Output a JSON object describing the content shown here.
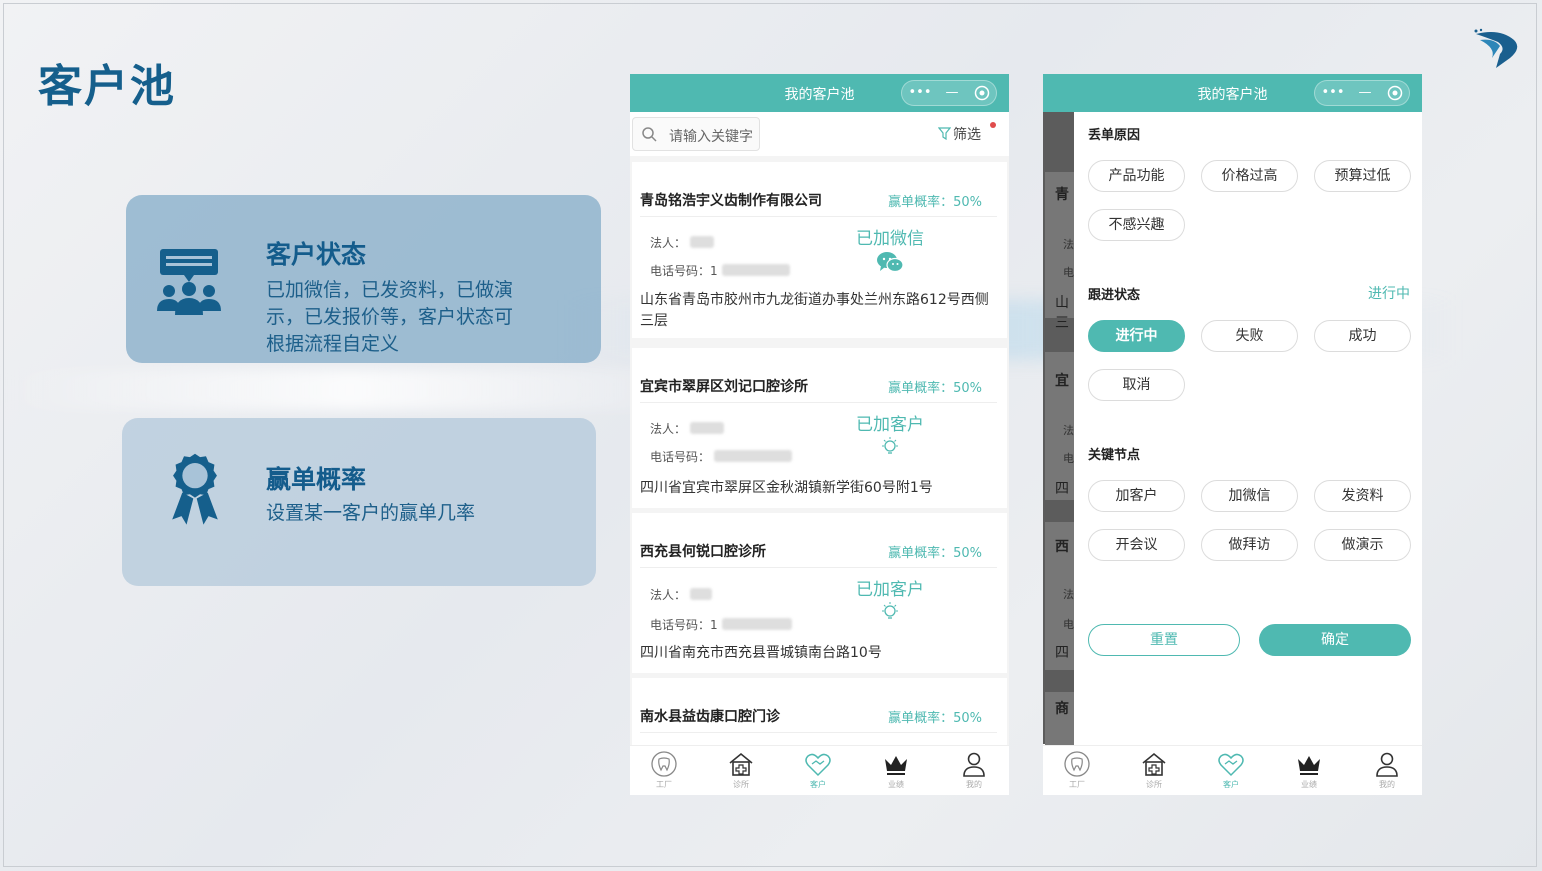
{
  "slide": {
    "title": "客户池",
    "features": [
      {
        "title": "客户状态",
        "description": "已加微信，已发资料，已做演示，已发报价等，客户状态可根据流程自定义",
        "icon": "presentation-people-icon"
      },
      {
        "title": "赢单概率",
        "description": "设置某一客户的赢单几率",
        "icon": "award-ribbon-icon"
      }
    ]
  },
  "colors": {
    "accent": "#4fb9b1",
    "title_blue": "#155f8c"
  },
  "app": {
    "header_title": "我的客户池",
    "capsule": {
      "more": "•••",
      "minimize": "—"
    },
    "search_placeholder": "请输入关键字",
    "filter_label": "筛选",
    "customers": [
      {
        "name": "青岛铭浩宇义齿制作有限公司",
        "rate": "赢单概率：50%",
        "legal_label": "法人：",
        "phone_label": "电话号码：",
        "phone_prefix": "1",
        "status": "已加微信",
        "status_icon": "wechat-icon",
        "address": "山东省青岛市胶州市九龙街道办事处兰州东路612号西侧三层"
      },
      {
        "name": "宜宾市翠屏区刘记口腔诊所",
        "rate": "赢单概率：50%",
        "legal_label": "法人：",
        "phone_label": "电话号码：",
        "phone_prefix": "",
        "status": "已加客户",
        "status_icon": "lightbulb-icon",
        "address": "四川省宜宾市翠屏区金秋湖镇新学街60号附1号"
      },
      {
        "name": "西充县何锐口腔诊所",
        "rate": "赢单概率：50%",
        "legal_label": "法人：",
        "phone_label": "电话号码：",
        "phone_prefix": "1",
        "status": "已加客户",
        "status_icon": "lightbulb-icon",
        "address": "四川省南充市西充县晋城镇南台路10号"
      },
      {
        "name": "南水县益齿康口腔门诊",
        "rate": "赢单概率：50%"
      }
    ],
    "tabs": [
      {
        "label": "工厂",
        "icon": "tooth-icon"
      },
      {
        "label": "诊所",
        "icon": "clinic-icon"
      },
      {
        "label": "客户",
        "icon": "handshake-heart-icon"
      },
      {
        "label": "业绩",
        "icon": "crown-icon"
      },
      {
        "label": "我的",
        "icon": "user-icon"
      }
    ],
    "filter_panel": {
      "lost_reason": {
        "title": "丢单原因",
        "options": [
          "产品功能",
          "价格过高",
          "预算过低",
          "不感兴趣"
        ]
      },
      "follow_status": {
        "title": "跟进状态",
        "current": "进行中",
        "options": [
          "进行中",
          "失败",
          "成功",
          "取消"
        ],
        "selected": "进行中"
      },
      "key_nodes": {
        "title": "关键节点",
        "options": [
          "加客户",
          "加微信",
          "发资料",
          "开会议",
          "做拜访",
          "做演示"
        ]
      },
      "reset_label": "重置",
      "confirm_label": "确定"
    },
    "overlay_fragments": [
      "青",
      "法",
      "电",
      "山",
      "三",
      "宜",
      "法",
      "电",
      "四",
      "西",
      "法",
      "电",
      "四",
      "商"
    ]
  }
}
